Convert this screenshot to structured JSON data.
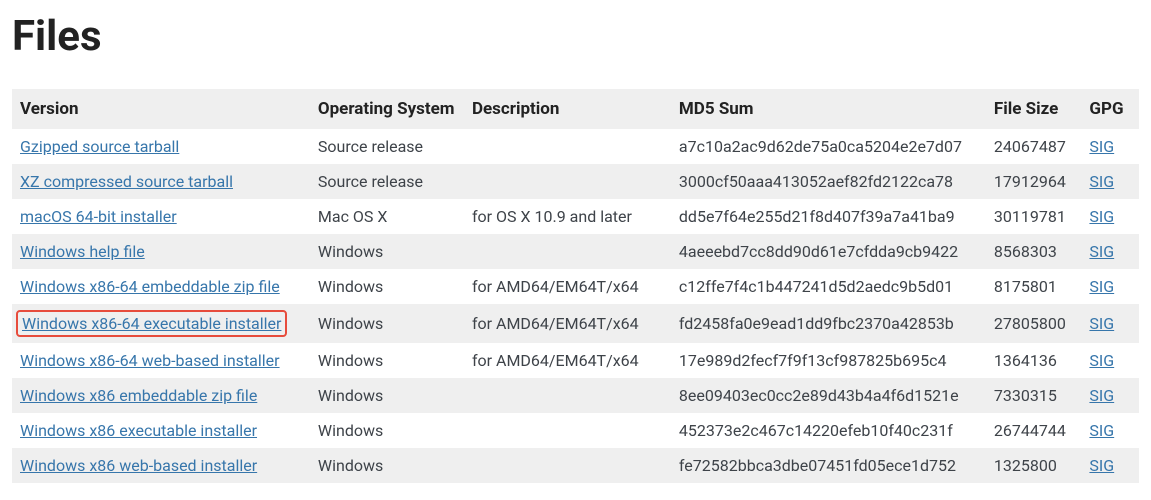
{
  "heading": "Files",
  "table": {
    "headers": {
      "version": "Version",
      "os": "Operating System",
      "description": "Description",
      "md5": "MD5 Sum",
      "size": "File Size",
      "gpg": "GPG"
    },
    "rows": [
      {
        "version": "Gzipped source tarball",
        "os": "Source release",
        "description": "",
        "md5": "a7c10a2ac9d62de75a0ca5204e2e7d07",
        "size": "24067487",
        "gpg": "SIG",
        "highlighted": false
      },
      {
        "version": "XZ compressed source tarball",
        "os": "Source release",
        "description": "",
        "md5": "3000cf50aaa413052aef82fd2122ca78",
        "size": "17912964",
        "gpg": "SIG",
        "highlighted": false
      },
      {
        "version": "macOS 64-bit installer",
        "os": "Mac OS X",
        "description": "for OS X 10.9 and later",
        "md5": "dd5e7f64e255d21f8d407f39a7a41ba9",
        "size": "30119781",
        "gpg": "SIG",
        "highlighted": false
      },
      {
        "version": "Windows help file",
        "os": "Windows",
        "description": "",
        "md5": "4aeeebd7cc8dd90d61e7cfdda9cb9422",
        "size": "8568303",
        "gpg": "SIG",
        "highlighted": false
      },
      {
        "version": "Windows x86-64 embeddable zip file",
        "os": "Windows",
        "description": "for AMD64/EM64T/x64",
        "md5": "c12ffe7f4c1b447241d5d2aedc9b5d01",
        "size": "8175801",
        "gpg": "SIG",
        "highlighted": false
      },
      {
        "version": "Windows x86-64 executable installer",
        "os": "Windows",
        "description": "for AMD64/EM64T/x64",
        "md5": "fd2458fa0e9ead1dd9fbc2370a42853b",
        "size": "27805800",
        "gpg": "SIG",
        "highlighted": true
      },
      {
        "version": "Windows x86-64 web-based installer",
        "os": "Windows",
        "description": "for AMD64/EM64T/x64",
        "md5": "17e989d2fecf7f9f13cf987825b695c4",
        "size": "1364136",
        "gpg": "SIG",
        "highlighted": false
      },
      {
        "version": "Windows x86 embeddable zip file",
        "os": "Windows",
        "description": "",
        "md5": "8ee09403ec0cc2e89d43b4a4f6d1521e",
        "size": "7330315",
        "gpg": "SIG",
        "highlighted": false
      },
      {
        "version": "Windows x86 executable installer",
        "os": "Windows",
        "description": "",
        "md5": "452373e2c467c14220efeb10f40c231f",
        "size": "26744744",
        "gpg": "SIG",
        "highlighted": false
      },
      {
        "version": "Windows x86 web-based installer",
        "os": "Windows",
        "description": "",
        "md5": "fe72582bbca3dbe07451fd05ece1d752",
        "size": "1325800",
        "gpg": "SIG",
        "highlighted": false
      }
    ]
  }
}
